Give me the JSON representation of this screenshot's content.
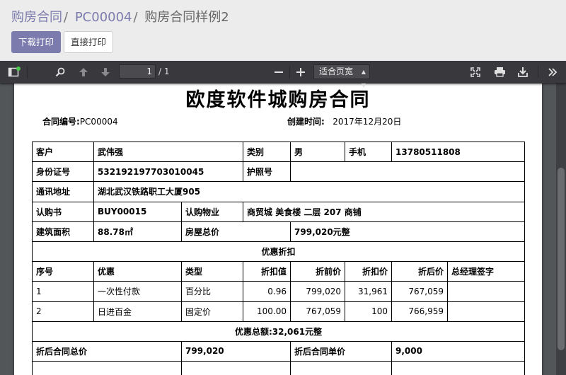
{
  "breadcrumb": {
    "item1": "购房合同",
    "item2": "PC00004",
    "current": "购房合同样例2",
    "separator": "/"
  },
  "actions": {
    "download_print": "下载打印",
    "direct_print": "直接打印"
  },
  "pdf_toolbar": {
    "page_current": "1",
    "page_total": "/ 1",
    "zoom": "适合页宽",
    "zoom_options": [
      "适合页宽"
    ]
  },
  "document": {
    "title": "欧度软件城购房合同",
    "contract_no_label": "合同编号:",
    "contract_no": "PC00004",
    "created_label": "创建时间:",
    "created": "2017年12月20日",
    "customer": {
      "label": "客户",
      "value": "武伟强",
      "category_label": "类别",
      "category": "男",
      "phone_label": "手机",
      "phone": "13780511808"
    },
    "id_card": {
      "label": "身份证号",
      "value": "532192197703010045",
      "passport_label": "护照号",
      "passport": ""
    },
    "address": {
      "label": "通讯地址",
      "value": "湖北武汉铁路职工大厦905"
    },
    "subscription": {
      "label": "认购书",
      "value": "BUY00015",
      "property_label": "认购物业",
      "property": "商贸城 美食楼 二层 207 商铺"
    },
    "area": {
      "label": "建筑面积",
      "value": "88.78㎡",
      "total_label": "房屋总价",
      "total": "799,020元整"
    },
    "discount_section": "优惠折扣",
    "discount_headers": [
      "序号",
      "优惠",
      "类型",
      "折扣值",
      "折前价",
      "折扣价",
      "折后价",
      "总经理签字"
    ],
    "discount_rows": [
      [
        "1",
        "一次性付款",
        "百分比",
        "0.96",
        "799,020",
        "31,961",
        "767,059",
        ""
      ],
      [
        "2",
        "日进百金",
        "固定价",
        "100.00",
        "767,059",
        "100",
        "766,959",
        ""
      ]
    ],
    "discount_total": "优惠总额:32,061元整",
    "after_discount": {
      "total_label": "折后合同总价",
      "total": "799,020",
      "unit_label": "折后合同单价",
      "unit": "9,000"
    }
  }
}
